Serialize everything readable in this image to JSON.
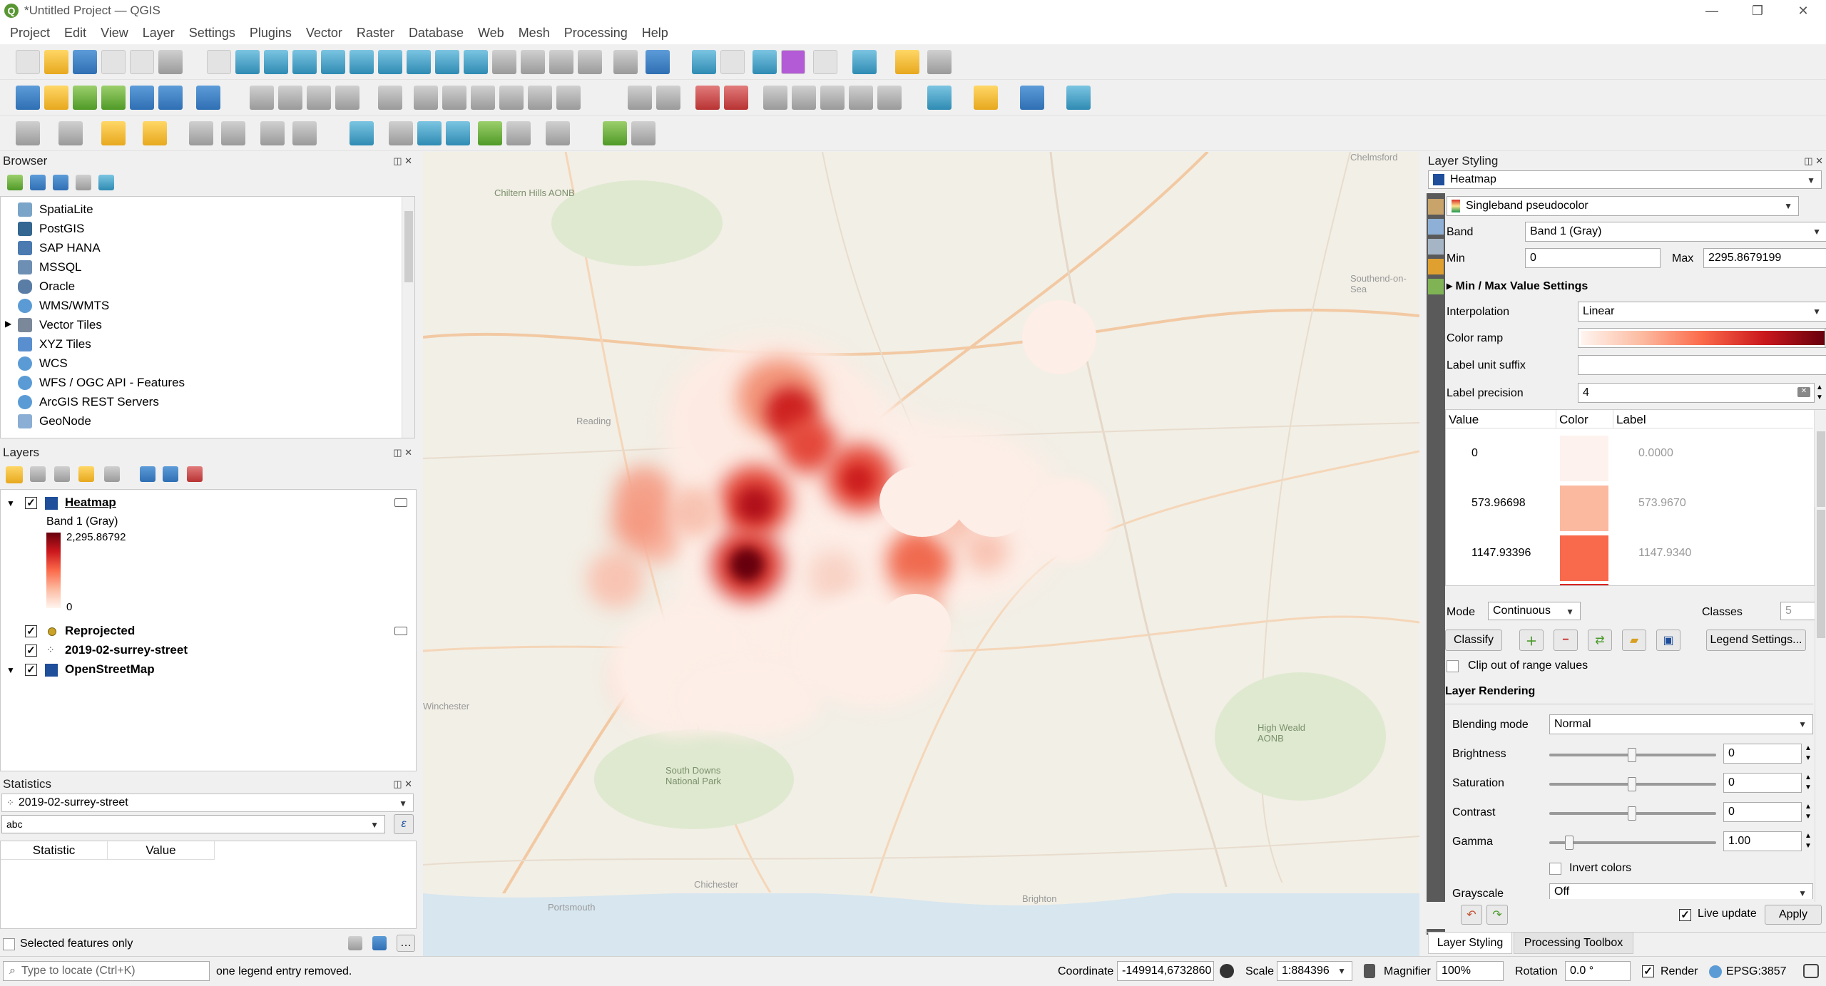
{
  "window": {
    "title": "*Untitled Project — QGIS",
    "app_logo": "Q"
  },
  "menus": [
    "Project",
    "Edit",
    "View",
    "Layer",
    "Settings",
    "Plugins",
    "Vector",
    "Raster",
    "Database",
    "Web",
    "Mesh",
    "Processing",
    "Help"
  ],
  "browser": {
    "title": "Browser",
    "items": [
      "SpatiaLite",
      "PostGIS",
      "SAP HANA",
      "MSSQL",
      "Oracle",
      "WMS/WMTS",
      "Vector Tiles",
      "XYZ Tiles",
      "WCS",
      "WFS / OGC API - Features",
      "ArcGIS REST Servers",
      "GeoNode"
    ]
  },
  "layers": {
    "title": "Layers",
    "heatmap": "Heatmap",
    "band": "Band 1 (Gray)",
    "max": "2,295.86792",
    "min": "0",
    "reprojected": "Reprojected",
    "street": "2019-02-surrey-street",
    "osm": "OpenStreetMap"
  },
  "statistics": {
    "title": "Statistics",
    "layer": "2019-02-surrey-street",
    "field": "abc",
    "col_stat": "Statistic",
    "col_value": "Value",
    "selected_only": "Selected features only"
  },
  "styling": {
    "title": "Layer Styling",
    "layer": "Heatmap",
    "renderer": "Singleband pseudocolor",
    "band_label": "Band",
    "band": "Band 1 (Gray)",
    "min_label": "Min",
    "min": "0",
    "max_label": "Max",
    "max": "2295.8679199",
    "minmax_settings": "Min / Max Value Settings",
    "interp_label": "Interpolation",
    "interp": "Linear",
    "ramp_label": "Color ramp",
    "suffix_label": "Label unit suffix",
    "precision_label": "Label precision",
    "precision": "4",
    "col_value": "Value",
    "col_color": "Color",
    "col_label": "Label",
    "rows": [
      {
        "value": "0",
        "label": "0.0000",
        "color": "#fdf2ee"
      },
      {
        "value": "573.96698",
        "label": "573.9670",
        "color": "#fbb9a0"
      },
      {
        "value": "1147.93396",
        "label": "1147.9340",
        "color": "#f9694c"
      }
    ],
    "mode_label": "Mode",
    "mode": "Continuous",
    "classes_label": "Classes",
    "classes": "5",
    "classify": "Classify",
    "legend_settings": "Legend Settings...",
    "clip": "Clip out of range values",
    "rendering": "Layer Rendering",
    "blend_label": "Blending mode",
    "blend": "Normal",
    "brightness_label": "Brightness",
    "brightness": "0",
    "saturation_label": "Saturation",
    "saturation": "0",
    "contrast_label": "Contrast",
    "contrast": "0",
    "gamma_label": "Gamma",
    "gamma": "1.00",
    "invert": "Invert colors",
    "grayscale_label": "Grayscale",
    "grayscale": "Off",
    "live_update": "Live update",
    "apply": "Apply",
    "tab1": "Layer Styling",
    "tab2": "Processing Toolbox"
  },
  "status": {
    "locate_placeholder": "Type to locate (Ctrl+K)",
    "message": "one legend entry removed.",
    "coord_label": "Coordinate",
    "coord": "-149914,6732860",
    "scale_label": "Scale",
    "scale": "1:884396",
    "magnifier_label": "Magnifier",
    "magnifier": "100%",
    "rotation_label": "Rotation",
    "rotation": "0.0 °",
    "render": "Render",
    "crs": "EPSG:3857"
  },
  "map_labels": [
    "Chiltern Hills AONB",
    "South Downs National Park",
    "High Weald AONB",
    "Brighton",
    "Chichester",
    "Portsmouth",
    "Winchester",
    "Reading",
    "Chelmsford",
    "Southend-on-Sea"
  ]
}
